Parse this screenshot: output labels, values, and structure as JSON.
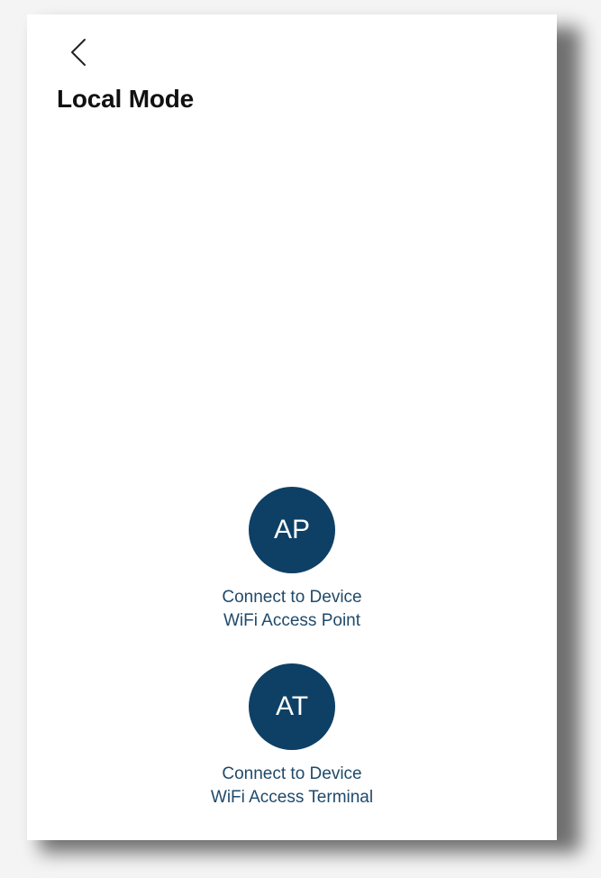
{
  "header": {
    "back_icon": "chevron-left-icon",
    "title": "Local Mode"
  },
  "options": [
    {
      "badge": "AP",
      "line1": "Connect to Device",
      "line2": "WiFi Access Point"
    },
    {
      "badge": "AT",
      "line1": "Connect to Device",
      "line2": "WiFi Access Terminal"
    }
  ],
  "colors": {
    "accent": "#0e4066",
    "caption_text": "#1f4a6b",
    "title_text": "#111111",
    "background": "#ffffff"
  }
}
